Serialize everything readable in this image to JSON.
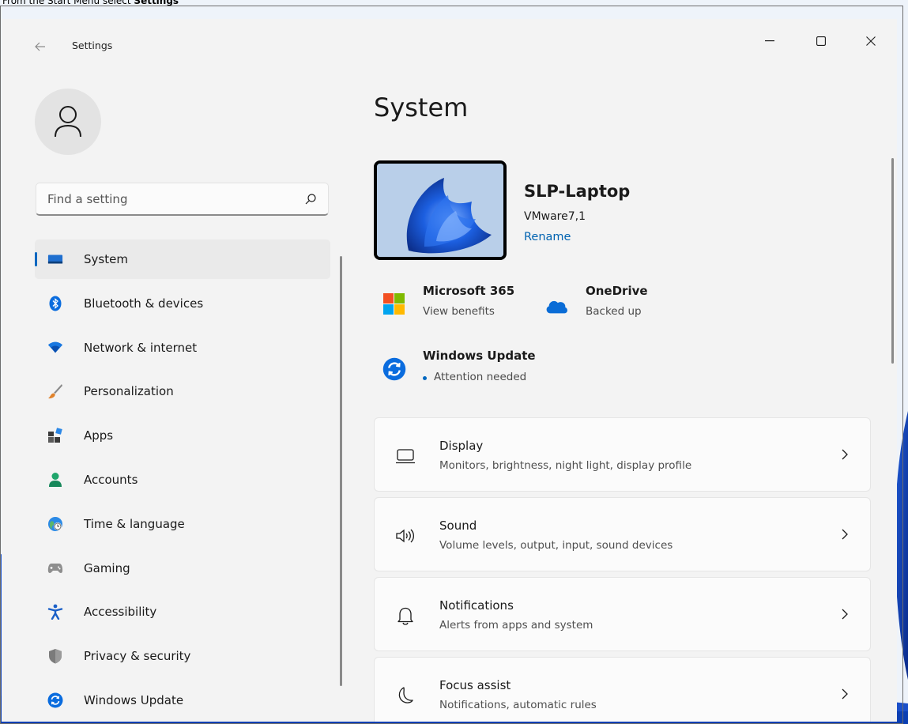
{
  "caption": {
    "prefix": "From the Start Menu select ",
    "bold": "Settings"
  },
  "titlebar": {
    "back_icon": "arrow-left-icon",
    "title": "Settings",
    "minimize_icon": "minimize-icon",
    "maximize_icon": "maximize-icon",
    "close_icon": "close-icon"
  },
  "search": {
    "placeholder": "Find a setting",
    "value": "",
    "icon": "search-icon"
  },
  "nav": {
    "items": [
      {
        "label": "System",
        "icon": "system-icon",
        "active": true
      },
      {
        "label": "Bluetooth & devices",
        "icon": "bluetooth-icon"
      },
      {
        "label": "Network & internet",
        "icon": "wifi-icon"
      },
      {
        "label": "Personalization",
        "icon": "brush-icon"
      },
      {
        "label": "Apps",
        "icon": "apps-icon"
      },
      {
        "label": "Accounts",
        "icon": "accounts-icon"
      },
      {
        "label": "Time & language",
        "icon": "globe-clock-icon"
      },
      {
        "label": "Gaming",
        "icon": "gamepad-icon"
      },
      {
        "label": "Accessibility",
        "icon": "accessibility-icon"
      },
      {
        "label": "Privacy & security",
        "icon": "shield-icon"
      },
      {
        "label": "Windows Update",
        "icon": "windows-update-icon"
      }
    ]
  },
  "main": {
    "title": "System",
    "device": {
      "name": "SLP-Laptop",
      "model": "VMware7,1",
      "rename": "Rename"
    },
    "tiles": {
      "microsoft365": {
        "title": "Microsoft 365",
        "sub": "View benefits",
        "icon": "microsoft-logo-icon"
      },
      "onedrive": {
        "title": "OneDrive",
        "sub": "Backed up",
        "icon": "onedrive-cloud-icon"
      },
      "windows_update": {
        "title": "Windows Update",
        "sub": "Attention needed",
        "icon": "windows-update-icon",
        "status_color": "#0067c0"
      }
    },
    "cards": [
      {
        "title": "Display",
        "sub": "Monitors, brightness, night light, display profile",
        "icon": "display-icon"
      },
      {
        "title": "Sound",
        "sub": "Volume levels, output, input, sound devices",
        "icon": "speaker-icon"
      },
      {
        "title": "Notifications",
        "sub": "Alerts from apps and system",
        "icon": "bell-icon"
      },
      {
        "title": "Focus assist",
        "sub": "Notifications, automatic rules",
        "icon": "moon-icon"
      }
    ]
  },
  "colors": {
    "accent": "#0067c0",
    "window_bg": "#f3f3f3",
    "card_bg": "#fbfbfb"
  }
}
